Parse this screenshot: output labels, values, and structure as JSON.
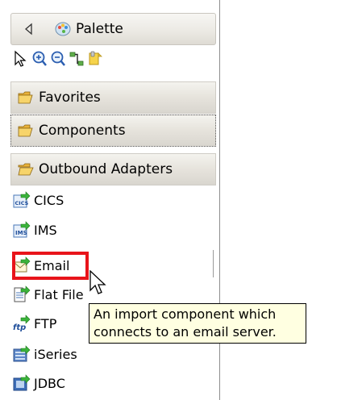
{
  "palette": {
    "title": "Palette",
    "tools": [
      {
        "name": "select-tool-icon"
      },
      {
        "name": "zoom-in-icon"
      },
      {
        "name": "zoom-out-icon"
      },
      {
        "name": "wire-connection-icon"
      },
      {
        "name": "note-icon"
      }
    ],
    "drawers": {
      "favorites": "Favorites",
      "components": "Components",
      "outbound": "Outbound Adapters"
    },
    "items": [
      {
        "label": "CICS",
        "icon": "cics-icon"
      },
      {
        "label": "IMS",
        "icon": "ims-icon"
      },
      {
        "label": "Email",
        "icon": "email-icon"
      },
      {
        "label": "Flat File",
        "icon": "flat-file-icon"
      },
      {
        "label": "FTP",
        "icon": "ftp-icon"
      },
      {
        "label": "iSeries",
        "icon": "iseries-icon"
      },
      {
        "label": "JDBC",
        "icon": "jdbc-icon"
      }
    ]
  },
  "tooltip": {
    "line1": "An import component which",
    "line2": "connects to an email server."
  },
  "colors": {
    "highlight": "#e8141a",
    "tooltip_bg": "#ffffe1",
    "arrow_green": "#2e9e2e"
  }
}
